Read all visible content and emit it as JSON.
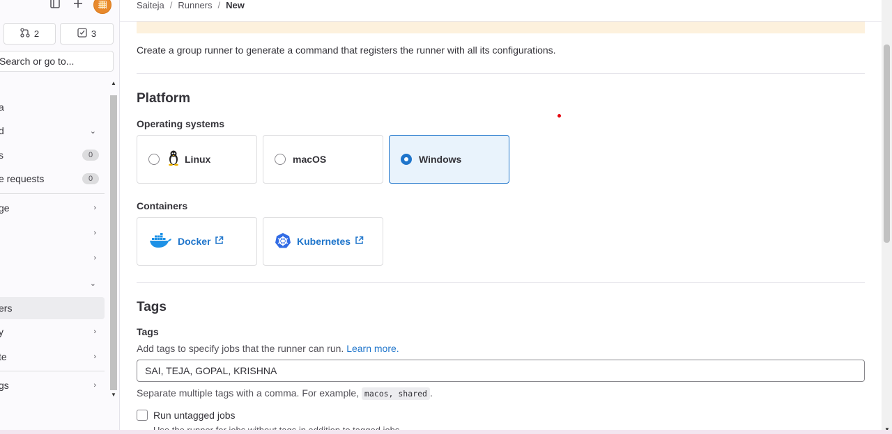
{
  "sidebar": {
    "merge_request_count": "2",
    "todo_count": "3",
    "search_placeholder": "Search or go to...",
    "items": [
      {
        "label": "a"
      },
      {
        "label": "d"
      },
      {
        "label": "s",
        "badge": "0"
      },
      {
        "label": "e requests",
        "badge": "0"
      },
      {
        "label": "ge"
      },
      {
        "label": ""
      },
      {
        "label": ""
      },
      {
        "label": ""
      },
      {
        "label": "ers"
      },
      {
        "label": "y"
      },
      {
        "label": "te"
      },
      {
        "label": "gs"
      }
    ]
  },
  "breadcrumb": {
    "items": [
      "Saiteja",
      "Runners",
      "New"
    ],
    "separator": "/"
  },
  "main": {
    "intro": "Create a group runner to generate a command that registers the runner with all its configurations.",
    "platform": {
      "heading": "Platform",
      "os_label": "Operating systems",
      "os_options": [
        {
          "label": "Linux",
          "selected": false
        },
        {
          "label": "macOS",
          "selected": false
        },
        {
          "label": "Windows",
          "selected": true
        }
      ],
      "containers_label": "Containers",
      "containers": [
        {
          "label": "Docker"
        },
        {
          "label": "Kubernetes"
        }
      ]
    },
    "tags": {
      "heading": "Tags",
      "label": "Tags",
      "help_text": "Add tags to specify jobs that the runner can run.",
      "learn_more": "Learn more.",
      "value": "SAI, TEJA, GOPAL, KRISHNA",
      "separator_help": "Separate multiple tags with a comma. For example,",
      "example_code": "macos, shared",
      "period": ".",
      "untagged_label": "Run untagged jobs",
      "untagged_help": "Use the runner for jobs without tags in addition to tagged jobs."
    }
  },
  "colors": {
    "accent": "#1f75cb",
    "alert_bg": "#fdf1dd",
    "selected_bg": "#e9f3fc"
  }
}
